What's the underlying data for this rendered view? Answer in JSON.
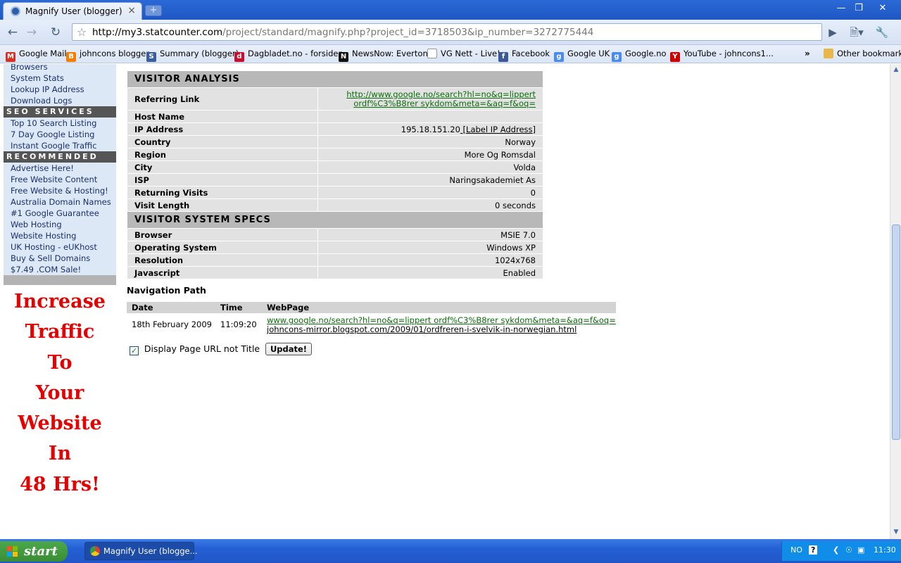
{
  "browser": {
    "tab_title": "Magnify User (blogger)",
    "tab_close": "×",
    "new_tab": "+",
    "url_host": "http://my3.statcounter.com",
    "url_path": "/project/standard/magnify.php?project_id=3718503&ip_number=3272775444",
    "bookmarks": [
      {
        "label": "Google Mail",
        "icon": "gmail-icon",
        "color": "#d93025",
        "glyph": "M"
      },
      {
        "label": "johncons blogger",
        "icon": "blogger-icon",
        "color": "#f57d00",
        "glyph": "B"
      },
      {
        "label": "Summary (blogger)",
        "icon": "statcounter-icon",
        "color": "#3a5f9a",
        "glyph": "S"
      },
      {
        "label": "Dagbladet.no - forsiden",
        "icon": "dagbladet-icon",
        "color": "#c8102e",
        "glyph": "d"
      },
      {
        "label": "NewsNow: Everton",
        "icon": "newsnow-icon",
        "color": "#111111",
        "glyph": "N"
      },
      {
        "label": "VG Nett - Live!",
        "icon": "page-icon",
        "color": "#ffffff",
        "glyph": ""
      },
      {
        "label": "Facebook",
        "icon": "facebook-icon",
        "color": "#3b5998",
        "glyph": "f"
      },
      {
        "label": "Google UK",
        "icon": "google-icon",
        "color": "#4a8af4",
        "glyph": "g"
      },
      {
        "label": "Google.no",
        "icon": "google-icon",
        "color": "#4a8af4",
        "glyph": "g"
      },
      {
        "label": "YouTube - johncons1...",
        "icon": "youtube-icon",
        "color": "#cc0000",
        "glyph": "Y"
      }
    ],
    "other_bookmarks": "Other bookmarks",
    "overflow": "»"
  },
  "sidebar": [
    {
      "type": "link",
      "label": "Browsers"
    },
    {
      "type": "link",
      "label": "System Stats"
    },
    {
      "type": "link",
      "label": "Lookup IP Address"
    },
    {
      "type": "link",
      "label": "Download Logs"
    },
    {
      "type": "head",
      "label": "SEO SERVICES"
    },
    {
      "type": "link",
      "label": "Top 10 Search Listing"
    },
    {
      "type": "link",
      "label": "7 Day Google Listing"
    },
    {
      "type": "link",
      "label": "Instant Google Traffic"
    },
    {
      "type": "head",
      "label": "RECOMMENDED"
    },
    {
      "type": "link",
      "label": "Advertise Here!"
    },
    {
      "type": "link",
      "label": "Free Website Content"
    },
    {
      "type": "link",
      "label": "Free Website & Hosting!"
    },
    {
      "type": "link",
      "label": "Australia Domain Names"
    },
    {
      "type": "link",
      "label": "#1 Google Guarantee"
    },
    {
      "type": "link",
      "label": "Web Hosting"
    },
    {
      "type": "link",
      "label": "Website Hosting"
    },
    {
      "type": "link",
      "label": "UK Hosting - eUKhost"
    },
    {
      "type": "link",
      "label": "Buy & Sell Domains"
    },
    {
      "type": "link",
      "label": "$7.49 .COM Sale!"
    }
  ],
  "ad": {
    "lines": [
      "Increase",
      "Traffic",
      "To",
      "Your",
      "Website",
      "In",
      "48 Hrs!"
    ],
    "color": "#e80000"
  },
  "analysis": {
    "visitor_header": "VISITOR ANALYSIS",
    "referring_label": "Referring Link",
    "referring_line1": "http://www.google.no/search?hl=no&q=lippert",
    "referring_line2": "ordf%C3%B8rer sykdom&meta=&aq=f&oq=",
    "rows": [
      {
        "label": "Host Name",
        "value": ""
      },
      {
        "label": "IP Address",
        "value": "195.18.151.20",
        "extra": "[Label IP Address]"
      },
      {
        "label": "Country",
        "value": "Norway"
      },
      {
        "label": "Region",
        "value": "More Og Romsdal"
      },
      {
        "label": "City",
        "value": "Volda"
      },
      {
        "label": "ISP",
        "value": "Naringsakademiet As"
      },
      {
        "label": "Returning Visits",
        "value": "0"
      },
      {
        "label": "Visit Length",
        "value": "0 seconds"
      }
    ],
    "specs_header": "VISITOR SYSTEM SPECS",
    "specs": [
      {
        "label": "Browser",
        "value": "MSIE 7.0"
      },
      {
        "label": "Operating System",
        "value": "Windows XP"
      },
      {
        "label": "Resolution",
        "value": "1024x768"
      },
      {
        "label": "Javascript",
        "value": "Enabled"
      }
    ]
  },
  "navigation": {
    "title": "Navigation Path",
    "headers": [
      "Date",
      "Time",
      "WebPage"
    ],
    "rows": [
      {
        "date": "18th February 2009",
        "time": "11:09:20",
        "link1": "www.google.no/search?hl=no&q=lippert ordf%C3%B8rer sykdom&meta=&aq=f&oq=",
        "link2": "johncons-mirror.blogspot.com/2009/01/ordfreren-i-svelvik-in-norwegian.html"
      }
    ],
    "option_label": "Display Page URL not Title",
    "option_checked": true,
    "update_label": "Update!"
  },
  "taskbar": {
    "start_label": "start",
    "task_label": "Magnify User (blogge...",
    "lang": "NO",
    "help": "?",
    "clock": "11:30"
  }
}
